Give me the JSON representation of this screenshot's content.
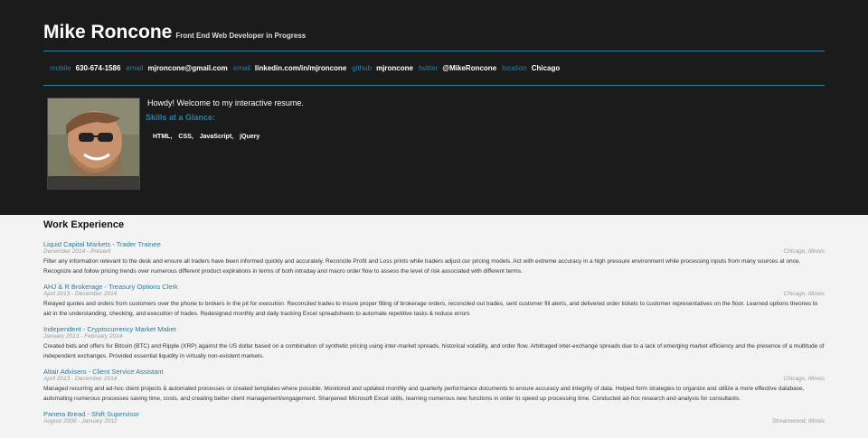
{
  "header": {
    "name": "Mike Roncone",
    "role": "Front End Web Developer in Progress"
  },
  "contacts": [
    {
      "label": "mobile",
      "value": "630-674-1586"
    },
    {
      "label": "email",
      "value": "mjroncone@gmail.com"
    },
    {
      "label": "email",
      "value": "linkedin.com/in/mjroncone"
    },
    {
      "label": "github",
      "value": "mjroncone"
    },
    {
      "label": "twitter",
      "value": "@MikeRoncone"
    },
    {
      "label": "location",
      "value": "Chicago"
    }
  ],
  "bio": {
    "welcome": "Howdy! Welcome to my interactive resume.",
    "skills_title": "Skills at a Glance:",
    "skills": [
      "HTML,",
      "CSS,",
      "JavaScript,",
      "jQuery"
    ]
  },
  "work": {
    "title": "Work Experience",
    "jobs": [
      {
        "title": "Liquid Capital Markets - Trader Trainee",
        "dates": "December 2014 - Present",
        "location": "Chicago, Illinois",
        "description": "Filter any information relevant to the desk and ensure all traders have been informed quickly and accurately. Reconcile Profit and Loss prints while traders adjust our pricing models. Act with extreme accuracy in a high pressure environment while processing inputs from many sources at once. Recognize and follow pricing trends over numerous different product expirations in terms of both intraday and macro order flow to assess the level of risk associated with different terms."
      },
      {
        "title": "AHJ & R Brokerage - Treasury Options Clerk",
        "dates": "April 2013 - December 2014",
        "location": "Chicago, Illinois",
        "description": "Relayed quotes and orders from customers over the phone to brokers in the pit for execution. Reconciled trades to insure proper filling of brokerage orders, reconciled out trades, sent customer fill alerts, and delivered order tickets to customer representatives on the floor. Learned options theories to aid in the understanding, checking, and execution of trades. Redesigned monthly and daily tracking Excel spreadsheets to automate repetitive tasks & reduce errors"
      },
      {
        "title": "Independent - Cryptocurrency Market Maker",
        "dates": "January 2013 - February 2014",
        "location": "",
        "description": "Created bids and offers for Bitcoin (BTC) and Ripple (XRP) against the US dollar based on a combination of synthetic pricing using inter-market spreads, historical volatility, and order flow. Arbitraged inter-exchange spreads due to a lack of emerging market efficiency and the presence of a multitude of independent exchanges. Provided essential liquidity in virtually non-existent markets."
      },
      {
        "title": "Altair Advisers - Client Service Assistant",
        "dates": "April 2013 - December 2014",
        "location": "Chicago, Illinois",
        "description": "Managed recurring and ad-hoc client projects & automated processes or created templates where possible. Monitored and updated monthly and quarterly performance documents to ensure accuracy and integrity of data. Helped form strategies to organize and utilize a more effective database, automating numerous processes saving time, costs, and creating better client management/engagement. Sharpened Microsoft Excel skills, learning numerous new functions in order to speed up processing time. Conducted ad-hoc research and analysis for consultants."
      },
      {
        "title": "Panera Bread - Shift Supervisor",
        "dates": "August 2008 - January 2012",
        "location": "Streamwood, Illinois",
        "description": ""
      }
    ]
  }
}
